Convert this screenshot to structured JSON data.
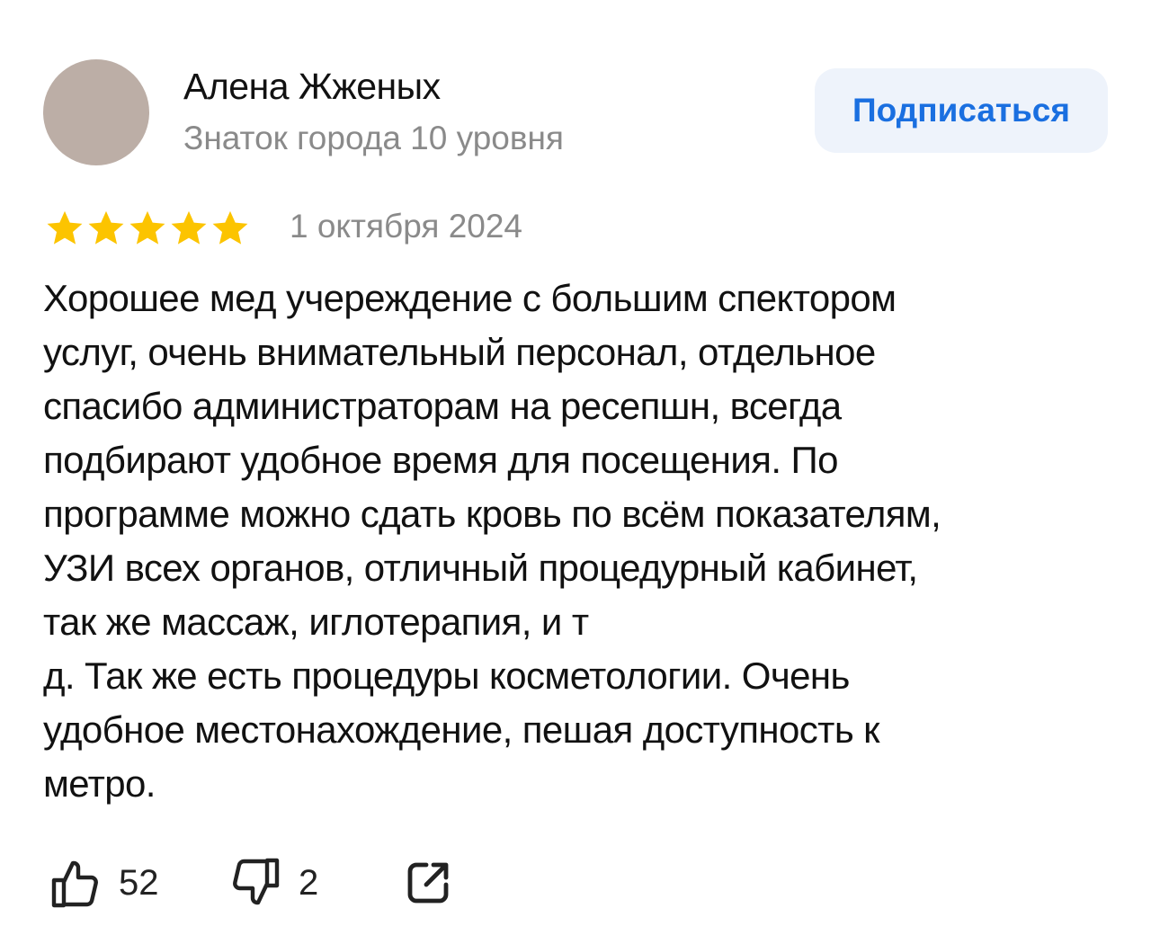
{
  "author": {
    "name": "Алена Жженых",
    "level": "Знаток города 10 уровня",
    "avatar_color": "#bcaea6"
  },
  "subscribe": {
    "label": "Подписаться",
    "color": "#1a6fe0",
    "background": "#eef3fb"
  },
  "review": {
    "rating": 5,
    "rating_max": 5,
    "star_color": "#fcc400",
    "date": "1 октября 2024",
    "text_lines": [
      "Хорошее мед учереждение с большим спектором",
      "услуг, очень внимательный персонал, отдельное",
      "спасибо администраторам на ресепшн, всегда",
      "подбирают удобное время для посещения. По",
      "программе можно сдать кровь по всём показателям,",
      "УЗИ всех органов, отличный процедурный кабинет,",
      "так же массаж, иглотерапия, и т",
      "д. Так же есть процедуры косметологии. Очень",
      "удобное местонахождение, пешая доступность к",
      "метро."
    ]
  },
  "actions": {
    "likes": "52",
    "dislikes": "2",
    "icons": [
      "thumbs-up-icon",
      "thumbs-down-icon",
      "share-icon"
    ]
  }
}
